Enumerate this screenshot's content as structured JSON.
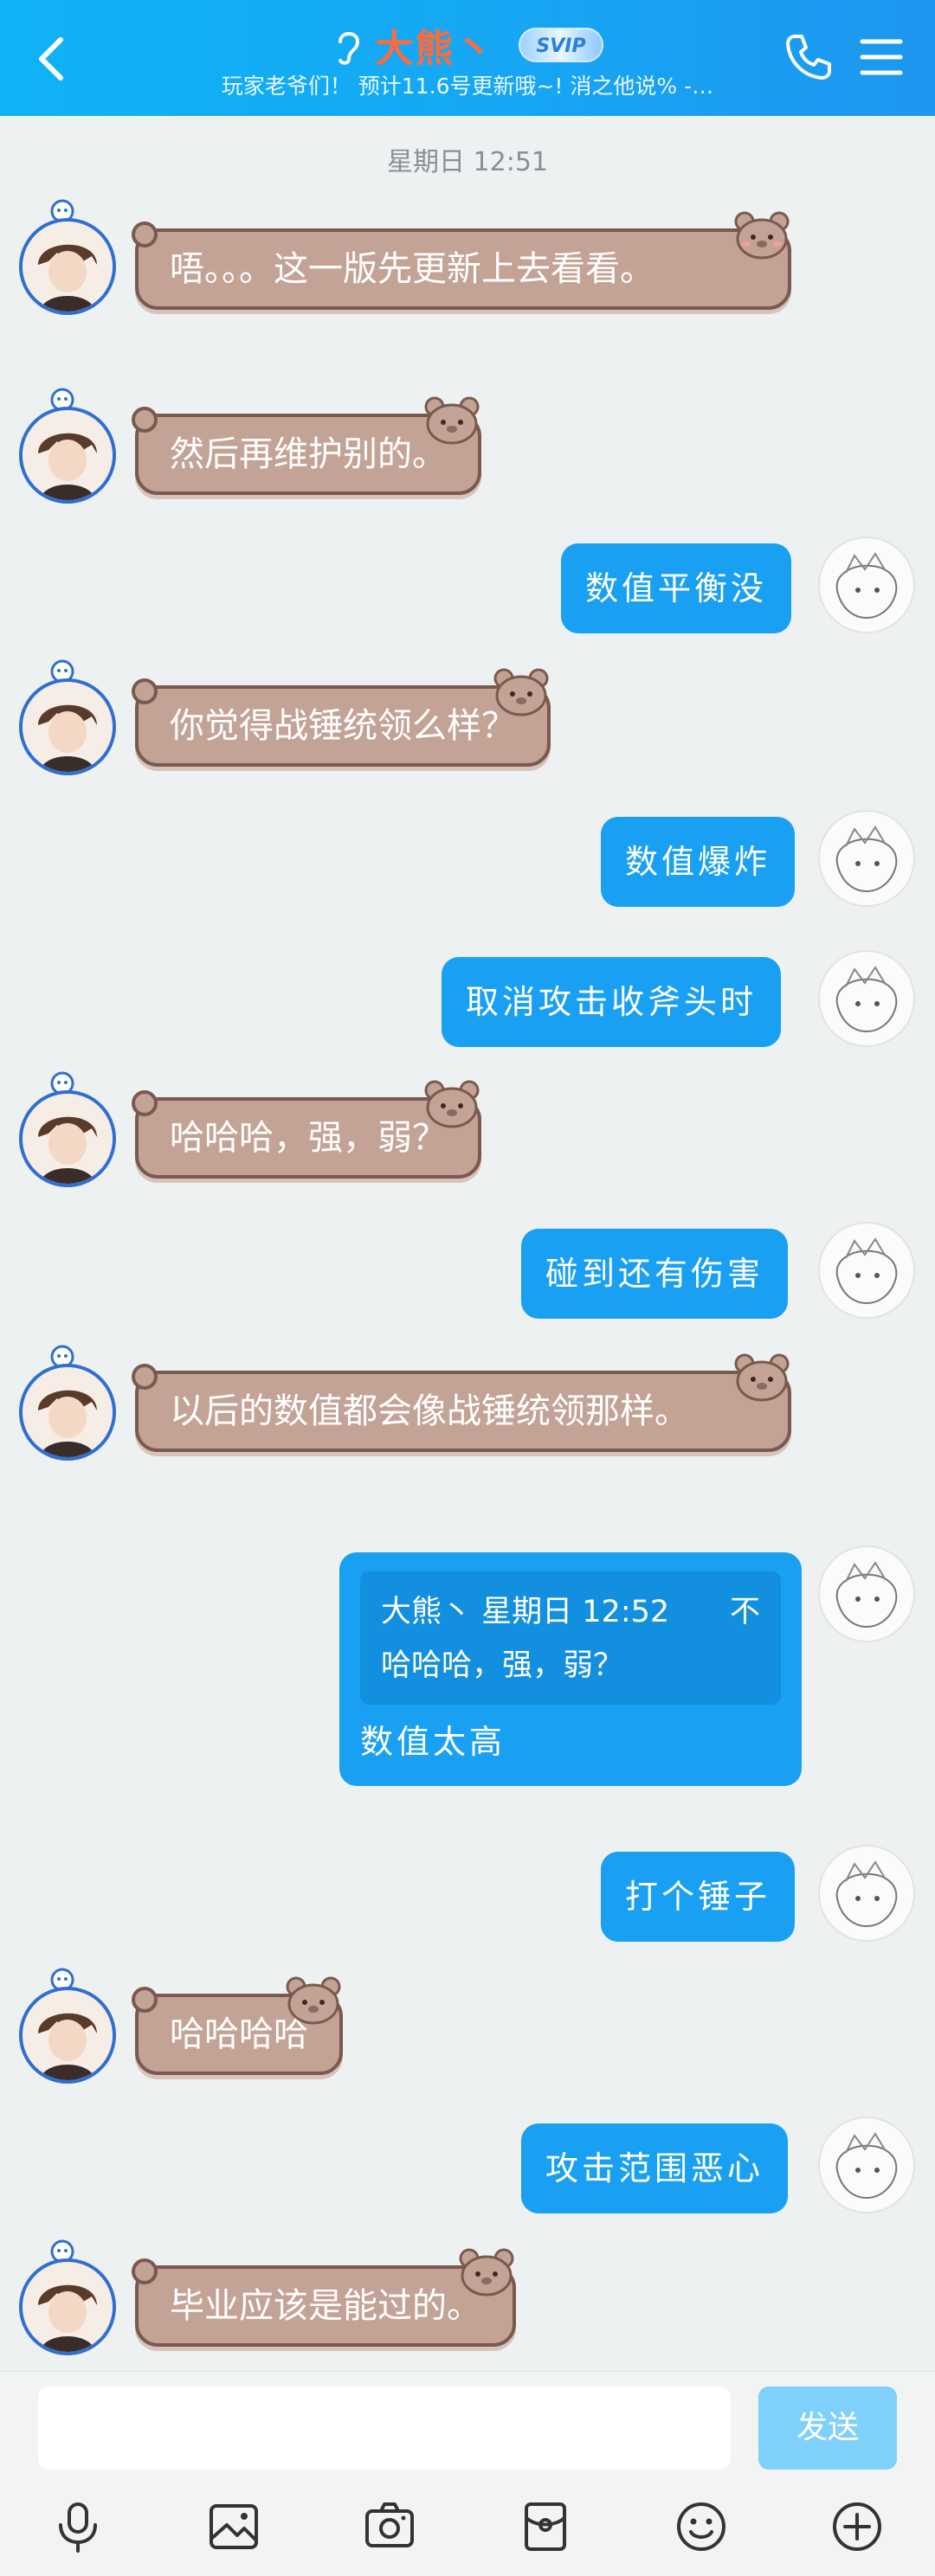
{
  "header": {
    "title": "大熊丶",
    "badge": "SVIP",
    "status": "玩家老爷们！ 预计11.6号更新哦~! 消之他说% -…"
  },
  "timestamp": "星期日 12:51",
  "messages": [
    {
      "side": "left",
      "text": "唔。。。这一版先更新上去看看。"
    },
    {
      "side": "left",
      "text": "然后再维护别的。"
    },
    {
      "side": "right",
      "text": "数值平衡没"
    },
    {
      "side": "left",
      "text": "你觉得战锤统领么样？"
    },
    {
      "side": "right",
      "text": "数值爆炸"
    },
    {
      "side": "right",
      "text": "取消攻击收斧头时"
    },
    {
      "side": "left",
      "text": "哈哈哈，强，弱？"
    },
    {
      "side": "right",
      "text": "碰到还有伤害"
    },
    {
      "side": "left",
      "text": "以后的数值都会像战锤统领那样。"
    },
    {
      "side": "right",
      "quote": {
        "author": "大熊丶",
        "time": "星期日 12:52",
        "extra": "不",
        "text": "哈哈哈，强，弱？"
      },
      "text": "数值太高"
    },
    {
      "side": "right",
      "text": "打个锤子"
    },
    {
      "side": "left",
      "text": "哈哈哈哈"
    },
    {
      "side": "right",
      "text": "攻击范围恶心"
    },
    {
      "side": "left",
      "text": "毕业应该是能过的。"
    }
  ],
  "input": {
    "placeholder": "",
    "value": ""
  },
  "send_label": "发送",
  "toolbar": {
    "icons": [
      "microphone-icon",
      "photo-icon",
      "camera-icon",
      "red-packet-icon",
      "emoji-icon",
      "plus-icon"
    ]
  },
  "colors": {
    "header": "#16a6f3",
    "self_bubble": "#1aa0f2",
    "other_bubble": "#c4a397",
    "name": "#ff6a3d"
  }
}
